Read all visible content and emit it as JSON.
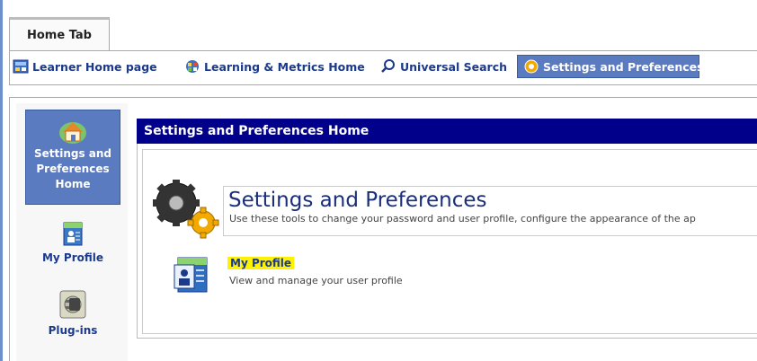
{
  "colors": {
    "accent_blue": "#5b7bc1",
    "header_navy": "#00008b",
    "link_blue": "#1b3a8c",
    "highlight_yellow": "#fff200"
  },
  "tabs": {
    "home_tab": "Home Tab"
  },
  "nav": {
    "items": [
      {
        "label": "Learner Home page",
        "icon": "learner-home-icon"
      },
      {
        "label": "Learning & Metrics Home",
        "icon": "learning-metrics-icon"
      },
      {
        "label": "Universal Search",
        "icon": "search-icon"
      },
      {
        "label": "Settings and Preferences",
        "icon": "settings-gear-icon",
        "active": true
      }
    ]
  },
  "sidebar": {
    "items": [
      {
        "label": "Settings and Preferences Home",
        "icon": "house-icon",
        "active": true
      },
      {
        "label": "My Profile",
        "icon": "profile-card-icon"
      },
      {
        "label": "Plug-ins",
        "icon": "plug-icon"
      }
    ]
  },
  "main": {
    "header": "Settings and Preferences Home",
    "section_title": "Settings and Preferences",
    "section_desc": "Use these tools to change your password and user profile, configure the appearance of the ap",
    "profile_link": "My Profile",
    "profile_desc": "View and manage your user profile"
  }
}
